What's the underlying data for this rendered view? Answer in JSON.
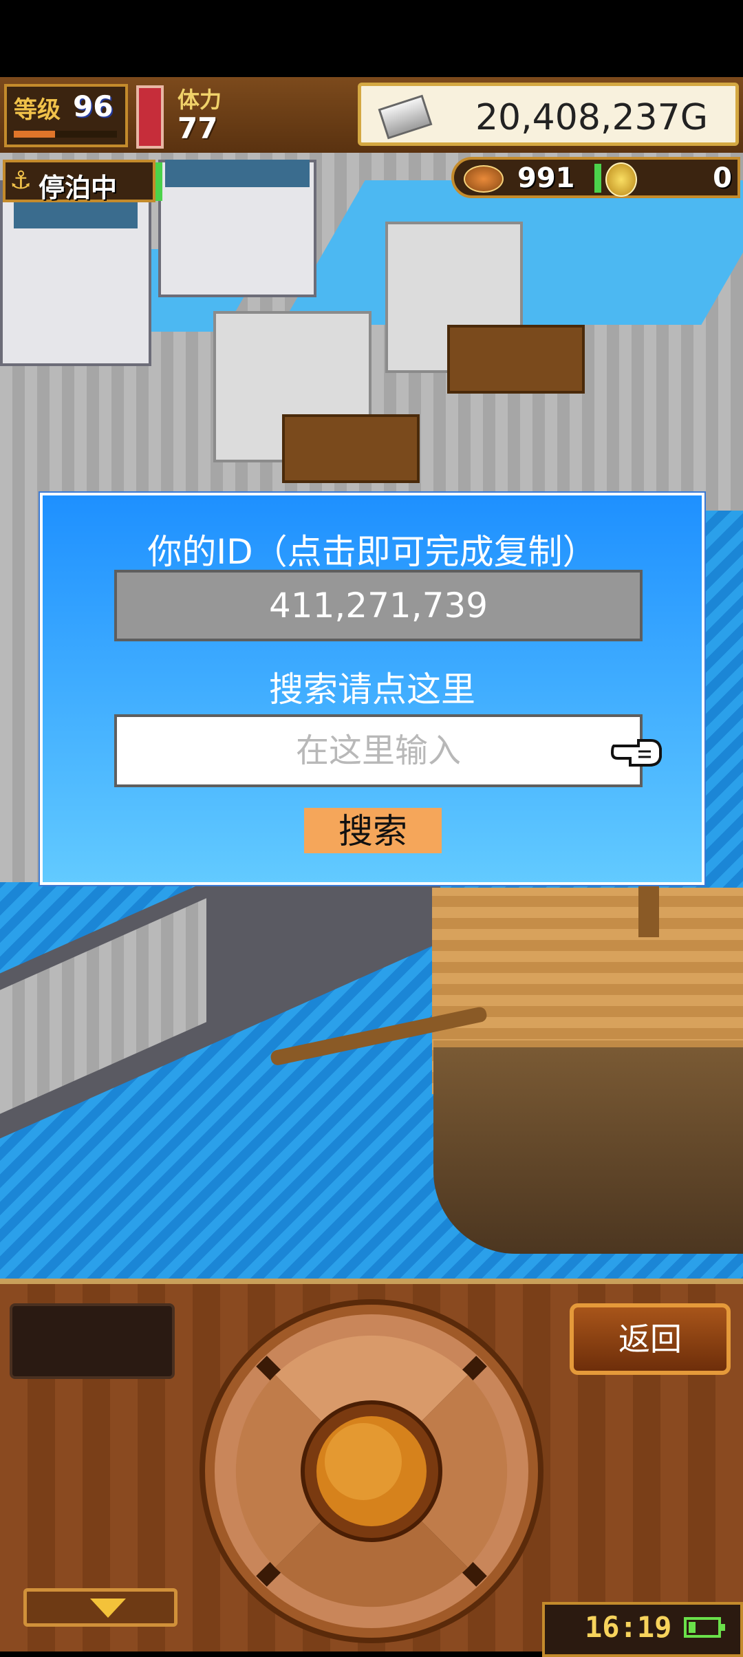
{
  "hud": {
    "level_label": "等级",
    "level_value": "96",
    "stamina_label": "体力",
    "stamina_value": "77",
    "gold_value": "20,408,237G",
    "anchor_status": "停泊中",
    "resource1_value": "991",
    "resource2_value": "0"
  },
  "dialog": {
    "title": "你的ID（点击即可完成复制）",
    "id_value": "411,271,739",
    "search_label": "搜索请点这里",
    "input_placeholder": "在这里输入",
    "input_value": "",
    "search_button": "搜索"
  },
  "controls": {
    "back_button": "返回",
    "clock": "16:19"
  },
  "colors": {
    "dialog_top": "#1e90ff",
    "dialog_bottom": "#62caff",
    "search_button": "#f5a65a",
    "id_box": "#979797",
    "hud_wood": "#7c4a1c"
  }
}
